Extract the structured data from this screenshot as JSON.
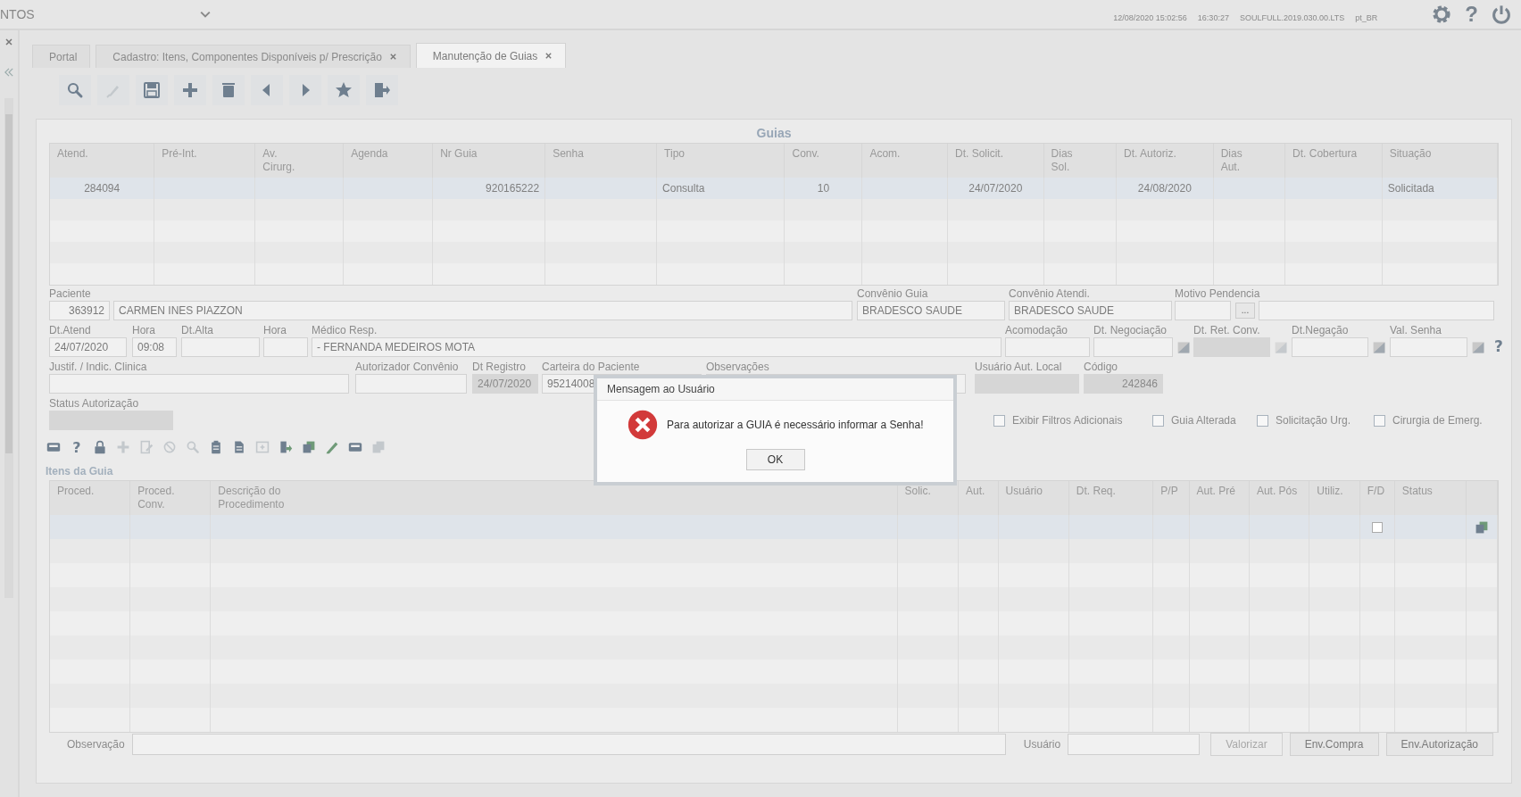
{
  "top_bar": {
    "module": "NTOS",
    "session_date": "12/08/2020 15:02:56",
    "time": "16:30:27",
    "version": "SOULFULL.2019.030.00.LTS",
    "locale": "pt_BR",
    "help": "?"
  },
  "tabs": [
    {
      "label": "Portal",
      "selected": false,
      "closable": false
    },
    {
      "label": "Cadastro: Itens, Componentes Disponíveis p/ Prescrição",
      "selected": false,
      "closable": true
    },
    {
      "label": "Manutenção de Guias",
      "selected": true,
      "closable": true
    }
  ],
  "toolbar": [
    {
      "kind": "search",
      "disabled": false
    },
    {
      "kind": "pen",
      "disabled": true
    },
    {
      "kind": "save",
      "disabled": false
    },
    {
      "kind": "plus",
      "disabled": false
    },
    {
      "kind": "trash",
      "disabled": false
    },
    {
      "kind": "left",
      "disabled": false
    },
    {
      "kind": "right",
      "disabled": false
    },
    {
      "kind": "star",
      "disabled": false
    },
    {
      "kind": "exit",
      "disabled": false
    }
  ],
  "guias": {
    "title": "Guias",
    "columns": [
      "Atend.",
      "Pré-Int.",
      "Av.\nCirurg.",
      "Agenda",
      "Nr Guia",
      "Senha",
      "Tipo",
      "Conv.",
      "Acom.",
      "Dt. Solicit.",
      "Dias\nSol.",
      "Dt. Autoriz.",
      "Dias\nAut.",
      "Dt. Cobertura",
      "Situação"
    ],
    "rows": [
      {
        "selected": true,
        "cells": [
          "284094",
          "",
          "",
          "",
          "920165222",
          "",
          "Consulta",
          "10",
          "",
          "24/07/2020",
          "",
          "24/08/2020",
          "",
          "",
          "Solicitada"
        ]
      }
    ]
  },
  "form": {
    "lines": [
      {
        "fields": [
          {
            "kind": "number",
            "label": "Paciente",
            "value": "363912",
            "disabled": false
          },
          {
            "kind": "text",
            "value": "CARMEN INES PIAZZON",
            "disabled": false
          },
          {
            "kind": "text",
            "label": "Convênio Guia",
            "value": "BRADESCO SAUDE",
            "disabled": false
          },
          {
            "kind": "text",
            "label": "Convênio Atendi.",
            "value": "BRADESCO SAUDE",
            "disabled": false
          },
          {
            "kind": "text",
            "label": "Motivo Pendencia",
            "disabled": false
          },
          {
            "kind": "button",
            "text": "...",
            "disabled": false
          },
          {
            "kind": "text",
            "disabled": false
          }
        ]
      },
      {
        "fields": [
          {
            "kind": "text",
            "label": "Dt.Atend",
            "value": "24/07/2020",
            "disabled": false
          },
          {
            "kind": "text",
            "label": "Hora",
            "value": "09:08",
            "disabled": false
          },
          {
            "kind": "text",
            "label": "Dt.Alta",
            "disabled": false
          },
          {
            "kind": "text",
            "label": "Hora",
            "disabled": false
          },
          {
            "kind": "text",
            "label": "Médico Resp.",
            "value": "- FERNANDA MEDEIROS MOTA",
            "disabled": false
          },
          {
            "kind": "text",
            "label": "Acomodação",
            "disabled": false
          },
          {
            "kind": "date",
            "label": "Dt. Negociação",
            "disabled": false
          },
          {
            "kind": "date",
            "label": "Dt. Ret. Conv.",
            "disabled": true
          },
          {
            "kind": "date",
            "label": "Dt.Negação",
            "disabled": false
          },
          {
            "kind": "date",
            "label": "Val. Senha",
            "disabled": false
          },
          {
            "kind": "help",
            "text": "?"
          }
        ]
      },
      {
        "fields": [
          {
            "kind": "text",
            "label": "Justif. / Indic. Clinica",
            "disabled": false
          },
          {
            "kind": "text",
            "label": "Autorizador Convênio",
            "disabled": false
          },
          {
            "kind": "text",
            "label": "Dt Registro",
            "value": "24/07/2020",
            "disabled": true
          },
          {
            "kind": "text",
            "label": "Carteira do Paciente",
            "value": "95214008",
            "disabled": false
          },
          {
            "kind": "text",
            "label": "Observações",
            "disabled": false
          },
          {
            "kind": "text",
            "label": "Usuário Aut. Local",
            "disabled": true
          },
          {
            "kind": "number",
            "label": "Código",
            "value": "242846",
            "disabled": true
          }
        ]
      },
      {
        "fields": [
          {
            "kind": "text",
            "label": "Status Autorização",
            "disabled": true
          },
          {
            "kind": "checkbox",
            "text": "Exibir Filtros Adicionais",
            "checked": false
          },
          {
            "kind": "checkbox",
            "text": "Guia Alterada",
            "checked": false
          },
          {
            "kind": "checkbox",
            "text": "Solicitação Urg.",
            "checked": false
          },
          {
            "kind": "checkbox",
            "text": "Cirurgia de Emerg.",
            "checked": false
          }
        ]
      }
    ]
  },
  "item_toolbar": [
    {
      "kind": "card",
      "disabled": false
    },
    {
      "kind": "help",
      "text": "?",
      "disabled": false
    },
    {
      "kind": "lock",
      "disabled": false
    },
    {
      "kind": "plus",
      "disabled": true
    },
    {
      "kind": "edit",
      "disabled": true
    },
    {
      "kind": "block",
      "disabled": true
    },
    {
      "kind": "search",
      "disabled": true
    },
    {
      "kind": "clipboard",
      "disabled": false
    },
    {
      "kind": "doc",
      "disabled": false
    },
    {
      "kind": "box",
      "disabled": true
    },
    {
      "kind": "docarrow",
      "disabled": false
    },
    {
      "kind": "copy",
      "disabled": false
    },
    {
      "kind": "pencil",
      "disabled": false
    },
    {
      "kind": "card",
      "disabled": false
    },
    {
      "kind": "copy",
      "disabled": true
    }
  ],
  "itens": {
    "title": "Itens da Guia",
    "columns": [
      "Proced.",
      "Proced.\nConv.",
      "Descrição do\nProcedimento",
      "Solic.",
      "Aut.",
      "Usuário",
      "Dt. Req.",
      "P/P",
      "Aut. Pré",
      "Aut. Pós",
      "Utiliz.",
      "F/D",
      "Status",
      ""
    ],
    "rows": [
      {
        "selected": true,
        "checked": false
      }
    ]
  },
  "footer": {
    "observacao_label": "Observação",
    "usuario_label": "Usuário",
    "buttons": [
      {
        "label": "Valorizar",
        "disabled": true
      },
      {
        "label": "Env.Compra",
        "disabled": false
      },
      {
        "label": "Env.Autorização",
        "disabled": false
      }
    ]
  },
  "dialog": {
    "title": "Mensagem ao Usuário",
    "message": "Para autorizar a GUIA é necessário informar a Senha!",
    "button": "OK"
  }
}
